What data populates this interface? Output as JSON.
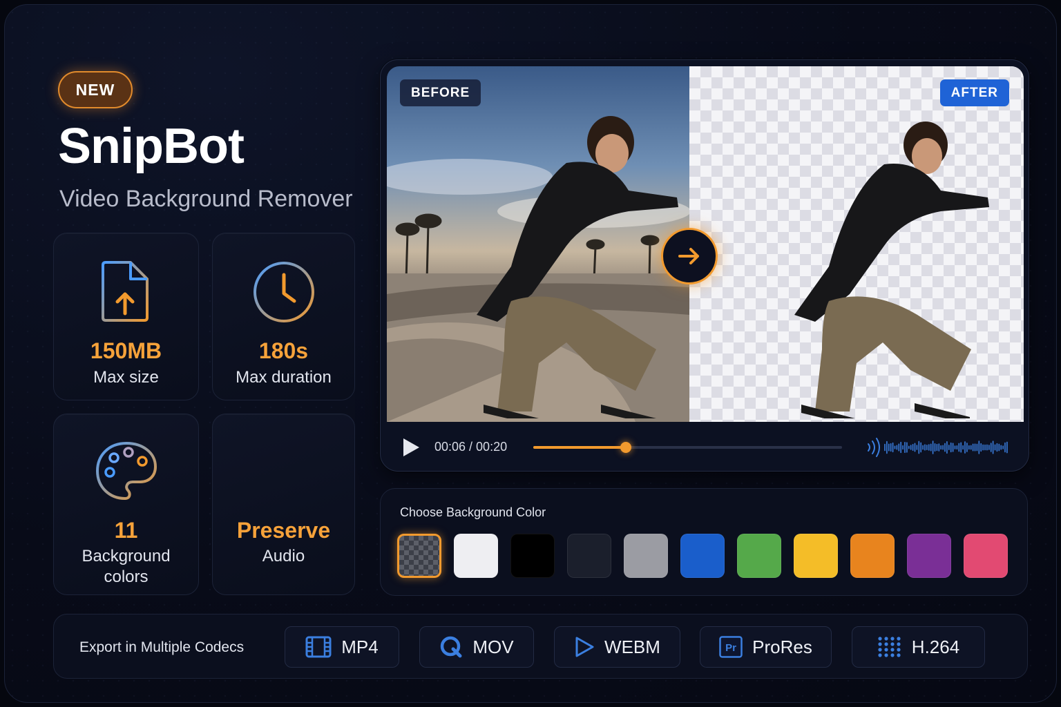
{
  "badge": "NEW",
  "app": {
    "title": "SnipBot",
    "subtitle": "Video Background Remover"
  },
  "stats": [
    {
      "icon": "file-upload-icon",
      "value": "150MB",
      "label": "Max size"
    },
    {
      "icon": "clock-icon",
      "value": "180s",
      "label": "Max duration"
    },
    {
      "icon": "palette-icon",
      "value": "11",
      "label_line1": "Background",
      "label_line2": "colors"
    },
    {
      "icon": "waveform-icon",
      "value": "Preserve",
      "label": "Audio"
    }
  ],
  "preview": {
    "before_tag": "BEFORE",
    "after_tag": "AFTER",
    "player": {
      "current": "00:06",
      "total": "00:20",
      "time_text": "00:06 / 00:20",
      "progress": 0.3
    }
  },
  "colors": {
    "title": "Choose Background Color",
    "selected_index": 0,
    "swatches": [
      "transparent",
      "#eeeef2",
      "#000000",
      "#1b1f2c",
      "#9b9ca3",
      "#1a5ecb",
      "#55a94a",
      "#f4bd28",
      "#e8841e",
      "#7a2f96",
      "#e24a72"
    ]
  },
  "export": {
    "title": "Export in Multiple Codecs",
    "codecs": [
      {
        "label": "MP4",
        "icon": "film-icon"
      },
      {
        "label": "MOV",
        "icon": "quicktime-icon"
      },
      {
        "label": "WEBM",
        "icon": "play-outline-icon"
      },
      {
        "label": "ProRes",
        "icon": "premiere-pro-icon"
      },
      {
        "label": "H.264",
        "icon": "dot-grid-icon"
      }
    ]
  },
  "accent": "#f29a2e",
  "accent_blue": "#4a9cff"
}
